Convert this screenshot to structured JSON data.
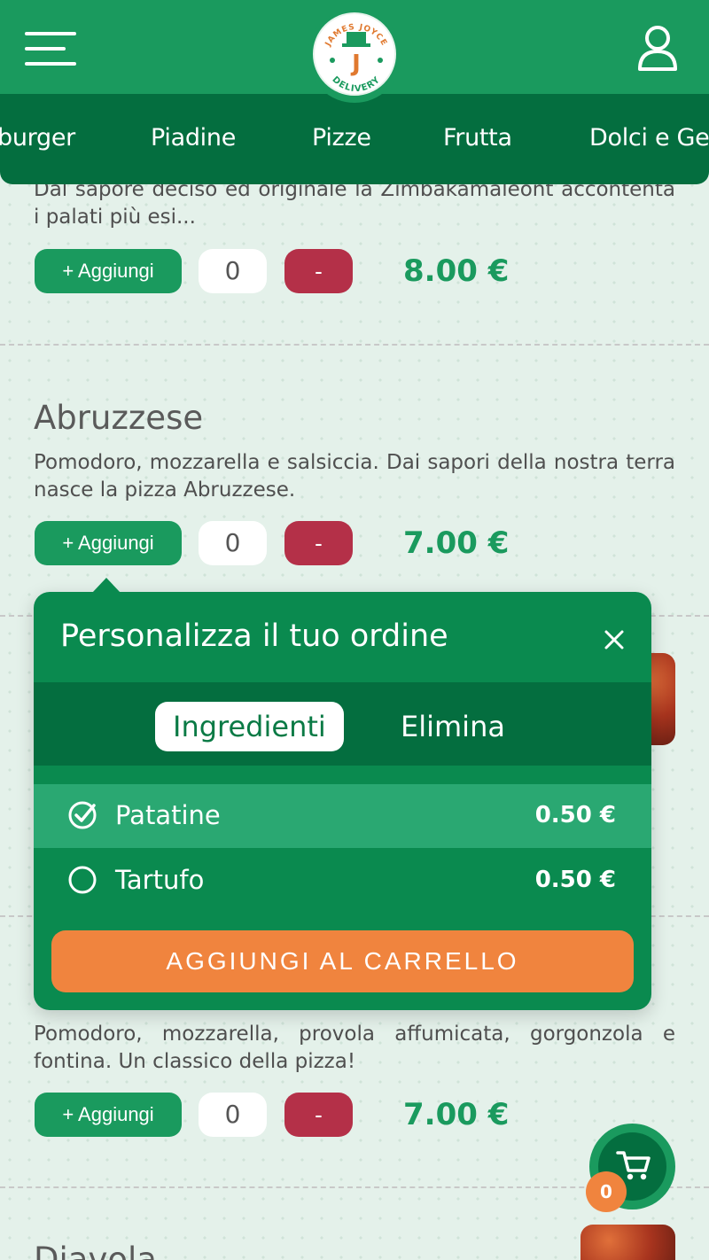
{
  "header": {
    "logo_top": "JAMES JOYCE",
    "logo_letter": "J",
    "logo_bottom": "DELIVERY"
  },
  "categories": [
    "burger",
    "Piadine",
    "Pizze",
    "Frutta",
    "Dolci e Ge"
  ],
  "products": [
    {
      "description": "Dal sapore deciso ed originale la Zimbakamaleont accontenta i palati più esi...",
      "add_label": "+ Aggiungi",
      "quantity": "0",
      "minus_label": "-",
      "price": "8.00 €"
    },
    {
      "title": "Abruzzese",
      "description": "Pomodoro, mozzarella e salsiccia. Dai sapori della nostra terra nasce la pizza Abruzzese.",
      "add_label": "+ Aggiungi",
      "quantity": "0",
      "minus_label": "-",
      "price": "7.00 €"
    },
    {
      "description": "Pomodoro, mozzarella, provola affumicata, gorgonzola e fontina. Un classico della pizza!",
      "add_label": "+ Aggiungi",
      "quantity": "0",
      "minus_label": "-",
      "price": "7.00 €"
    },
    {
      "title": "Diavola"
    }
  ],
  "popup": {
    "title": "Personalizza il tuo ordine",
    "tabs": [
      "Ingredienti",
      "Elimina"
    ],
    "active_tab": "Ingredienti",
    "options": [
      {
        "label": "Patatine",
        "price": "0.50 €",
        "checked": true
      },
      {
        "label": "Tartufo",
        "price": "0.50 €",
        "checked": false
      }
    ],
    "cta": "AGGIUNGI AL CARRELLO"
  },
  "cart": {
    "count": "0"
  },
  "colors": {
    "primary": "#1a9a5e",
    "dark": "#046e3f",
    "accent": "#f0843e",
    "danger": "#b43048"
  },
  "icons": [
    "menu-icon",
    "user-icon",
    "close-icon",
    "check-circle-icon",
    "circle-icon",
    "cart-icon"
  ]
}
